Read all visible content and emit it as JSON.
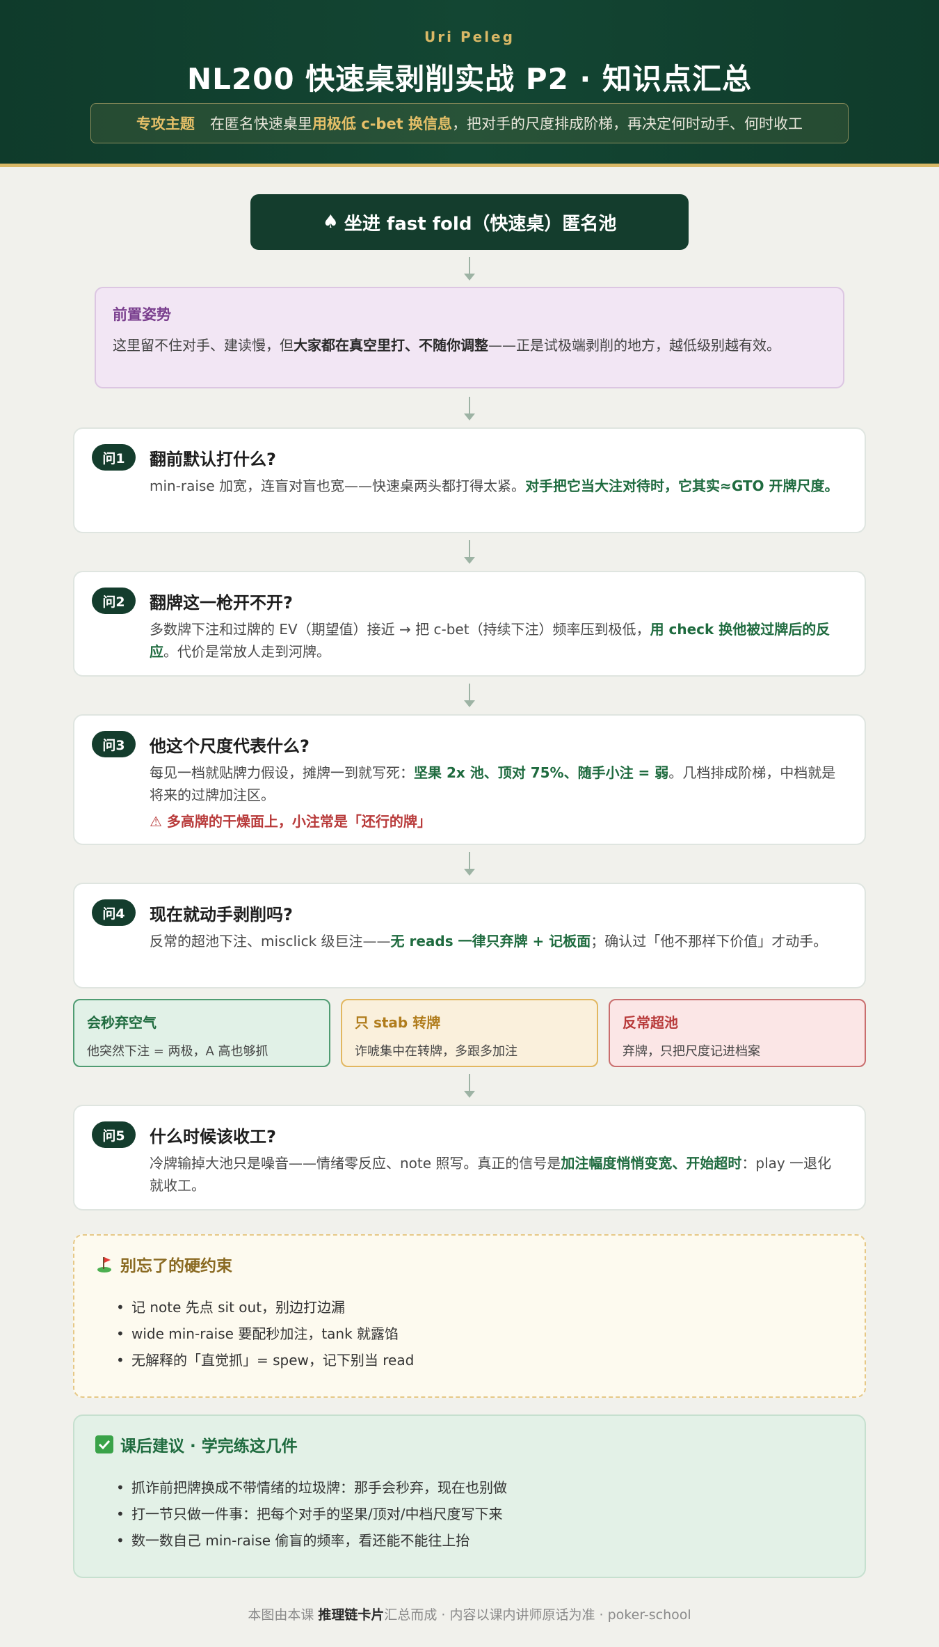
{
  "header": {
    "author": "Uri Peleg",
    "title": "NL200 快速桌剥削实战 P2 · 知识点汇总",
    "topic_label": "专攻主题",
    "topic_pre": "在匿名快速桌里",
    "topic_highlight": "用极低 c-bet 换信息",
    "topic_post": "，把对手的尺度排成阶梯，再决定何时动手、何时收工"
  },
  "start": {
    "icon": "spade-icon",
    "label": "坐进 fast fold（快速桌）匿名池"
  },
  "premise": {
    "title": "前置姿势",
    "text_pre": "这里留不住对手、建读慢，但",
    "text_bold": "大家都在真空里打、不随你调整",
    "text_post": "——正是试极端剥削的地方，越低级别越有效。"
  },
  "questions": [
    {
      "badge": "问1",
      "title": "翻前默认打什么?",
      "text_pre": "min-raise 加宽，连盲对盲也宽——快速桌两头都打得太紧。",
      "text_green": "对手把它当大注对待时，它其实≈GTO 开牌尺度。",
      "text_post": ""
    },
    {
      "badge": "问2",
      "title": "翻牌这一枪开不开?",
      "text_pre": "多数牌下注和过牌的 EV（期望值）接近 → 把 c-bet（持续下注）频率压到极低，",
      "text_green": "用 check 换他被过牌后的反应",
      "text_post": "。代价是常放人走到河牌。"
    },
    {
      "badge": "问3",
      "title": "他这个尺度代表什么?",
      "text_pre": "每见一档就贴牌力假设，摊牌一到就写死：",
      "text_green": "坚果 2x 池、顶对 75%、随手小注 = 弱",
      "text_post": "。几档排成阶梯，中档就是将来的过牌加注区。",
      "warning": "⚠ 多高牌的干燥面上，小注常是「还行的牌」"
    },
    {
      "badge": "问4",
      "title": "现在就动手剥削吗?",
      "text_pre": "反常的超池下注、misclick 级巨注——",
      "text_green": "无 reads 一律只弃牌 + 记板面",
      "text_post": "；确认过「他不那样下价值」才动手。"
    },
    {
      "badge": "问5",
      "title": "什么时候该收工?",
      "text_pre": "冷牌输掉大池只是噪音——情绪零反应、note 照写。真正的信号是",
      "text_green": "加注幅度悄悄变宽、开始超时",
      "text_post": "：play 一退化就收工。"
    }
  ],
  "outcomes": [
    {
      "title": "会秒弃空气",
      "text": "他突然下注 = 两极，A 高也够抓"
    },
    {
      "title": "只 stab 转牌",
      "text": "诈唬集中在转牌，多跟多加注"
    },
    {
      "title": "反常超池",
      "text": "弃牌，只把尺度记进档案"
    }
  ],
  "remember": {
    "icon": "flag-icon",
    "title": "别忘了的硬约束",
    "items": [
      "记 note 先点 sit out，别边打边漏",
      "wide min-raise 要配秒加注，tank 就露馅",
      "无解释的「直觉抓」= spew，记下别当 read"
    ]
  },
  "after": {
    "icon": "check-icon",
    "title": "课后建议 · 学完练这几件",
    "items": [
      "抓诈前把牌换成不带情绪的垃圾牌：那手会秒弃，现在也别做",
      "打一节只做一件事：把每个对手的坚果/顶对/中档尺度写下来",
      "数一数自己 min-raise 偷盲的频率，看还能不能往上抬"
    ]
  },
  "footer": {
    "pre": "本图由本课 ",
    "bold": "推理链卡片",
    "post": "汇总而成 · 内容以课内讲师原话为准 · poker-school"
  },
  "colors": {
    "header_bg": "#0f3b2b",
    "gold": "#d9b866",
    "accent_green": "#1f6b3f",
    "warning_red": "#b83a3a"
  }
}
